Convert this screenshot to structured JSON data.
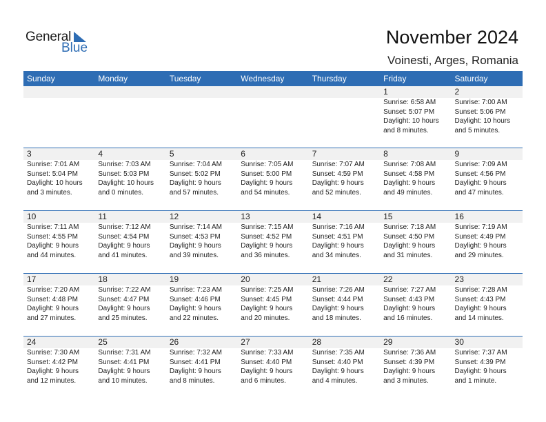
{
  "logo": {
    "line1": "General",
    "line2": "Blue"
  },
  "header": {
    "title": "November 2024",
    "location": "Voinesti, Arges, Romania"
  },
  "colors": {
    "accent": "#2E6DB4",
    "date_band": "#F1F1F1"
  },
  "weekdays": [
    "Sunday",
    "Monday",
    "Tuesday",
    "Wednesday",
    "Thursday",
    "Friday",
    "Saturday"
  ],
  "weeks": [
    [
      null,
      null,
      null,
      null,
      null,
      {
        "day": "1",
        "sunrise": "Sunrise: 6:58 AM",
        "sunset": "Sunset: 5:07 PM",
        "daylight1": "Daylight: 10 hours",
        "daylight2": "and 8 minutes."
      },
      {
        "day": "2",
        "sunrise": "Sunrise: 7:00 AM",
        "sunset": "Sunset: 5:06 PM",
        "daylight1": "Daylight: 10 hours",
        "daylight2": "and 5 minutes."
      }
    ],
    [
      {
        "day": "3",
        "sunrise": "Sunrise: 7:01 AM",
        "sunset": "Sunset: 5:04 PM",
        "daylight1": "Daylight: 10 hours",
        "daylight2": "and 3 minutes."
      },
      {
        "day": "4",
        "sunrise": "Sunrise: 7:03 AM",
        "sunset": "Sunset: 5:03 PM",
        "daylight1": "Daylight: 10 hours",
        "daylight2": "and 0 minutes."
      },
      {
        "day": "5",
        "sunrise": "Sunrise: 7:04 AM",
        "sunset": "Sunset: 5:02 PM",
        "daylight1": "Daylight: 9 hours",
        "daylight2": "and 57 minutes."
      },
      {
        "day": "6",
        "sunrise": "Sunrise: 7:05 AM",
        "sunset": "Sunset: 5:00 PM",
        "daylight1": "Daylight: 9 hours",
        "daylight2": "and 54 minutes."
      },
      {
        "day": "7",
        "sunrise": "Sunrise: 7:07 AM",
        "sunset": "Sunset: 4:59 PM",
        "daylight1": "Daylight: 9 hours",
        "daylight2": "and 52 minutes."
      },
      {
        "day": "8",
        "sunrise": "Sunrise: 7:08 AM",
        "sunset": "Sunset: 4:58 PM",
        "daylight1": "Daylight: 9 hours",
        "daylight2": "and 49 minutes."
      },
      {
        "day": "9",
        "sunrise": "Sunrise: 7:09 AM",
        "sunset": "Sunset: 4:56 PM",
        "daylight1": "Daylight: 9 hours",
        "daylight2": "and 47 minutes."
      }
    ],
    [
      {
        "day": "10",
        "sunrise": "Sunrise: 7:11 AM",
        "sunset": "Sunset: 4:55 PM",
        "daylight1": "Daylight: 9 hours",
        "daylight2": "and 44 minutes."
      },
      {
        "day": "11",
        "sunrise": "Sunrise: 7:12 AM",
        "sunset": "Sunset: 4:54 PM",
        "daylight1": "Daylight: 9 hours",
        "daylight2": "and 41 minutes."
      },
      {
        "day": "12",
        "sunrise": "Sunrise: 7:14 AM",
        "sunset": "Sunset: 4:53 PM",
        "daylight1": "Daylight: 9 hours",
        "daylight2": "and 39 minutes."
      },
      {
        "day": "13",
        "sunrise": "Sunrise: 7:15 AM",
        "sunset": "Sunset: 4:52 PM",
        "daylight1": "Daylight: 9 hours",
        "daylight2": "and 36 minutes."
      },
      {
        "day": "14",
        "sunrise": "Sunrise: 7:16 AM",
        "sunset": "Sunset: 4:51 PM",
        "daylight1": "Daylight: 9 hours",
        "daylight2": "and 34 minutes."
      },
      {
        "day": "15",
        "sunrise": "Sunrise: 7:18 AM",
        "sunset": "Sunset: 4:50 PM",
        "daylight1": "Daylight: 9 hours",
        "daylight2": "and 31 minutes."
      },
      {
        "day": "16",
        "sunrise": "Sunrise: 7:19 AM",
        "sunset": "Sunset: 4:49 PM",
        "daylight1": "Daylight: 9 hours",
        "daylight2": "and 29 minutes."
      }
    ],
    [
      {
        "day": "17",
        "sunrise": "Sunrise: 7:20 AM",
        "sunset": "Sunset: 4:48 PM",
        "daylight1": "Daylight: 9 hours",
        "daylight2": "and 27 minutes."
      },
      {
        "day": "18",
        "sunrise": "Sunrise: 7:22 AM",
        "sunset": "Sunset: 4:47 PM",
        "daylight1": "Daylight: 9 hours",
        "daylight2": "and 25 minutes."
      },
      {
        "day": "19",
        "sunrise": "Sunrise: 7:23 AM",
        "sunset": "Sunset: 4:46 PM",
        "daylight1": "Daylight: 9 hours",
        "daylight2": "and 22 minutes."
      },
      {
        "day": "20",
        "sunrise": "Sunrise: 7:25 AM",
        "sunset": "Sunset: 4:45 PM",
        "daylight1": "Daylight: 9 hours",
        "daylight2": "and 20 minutes."
      },
      {
        "day": "21",
        "sunrise": "Sunrise: 7:26 AM",
        "sunset": "Sunset: 4:44 PM",
        "daylight1": "Daylight: 9 hours",
        "daylight2": "and 18 minutes."
      },
      {
        "day": "22",
        "sunrise": "Sunrise: 7:27 AM",
        "sunset": "Sunset: 4:43 PM",
        "daylight1": "Daylight: 9 hours",
        "daylight2": "and 16 minutes."
      },
      {
        "day": "23",
        "sunrise": "Sunrise: 7:28 AM",
        "sunset": "Sunset: 4:43 PM",
        "daylight1": "Daylight: 9 hours",
        "daylight2": "and 14 minutes."
      }
    ],
    [
      {
        "day": "24",
        "sunrise": "Sunrise: 7:30 AM",
        "sunset": "Sunset: 4:42 PM",
        "daylight1": "Daylight: 9 hours",
        "daylight2": "and 12 minutes."
      },
      {
        "day": "25",
        "sunrise": "Sunrise: 7:31 AM",
        "sunset": "Sunset: 4:41 PM",
        "daylight1": "Daylight: 9 hours",
        "daylight2": "and 10 minutes."
      },
      {
        "day": "26",
        "sunrise": "Sunrise: 7:32 AM",
        "sunset": "Sunset: 4:41 PM",
        "daylight1": "Daylight: 9 hours",
        "daylight2": "and 8 minutes."
      },
      {
        "day": "27",
        "sunrise": "Sunrise: 7:33 AM",
        "sunset": "Sunset: 4:40 PM",
        "daylight1": "Daylight: 9 hours",
        "daylight2": "and 6 minutes."
      },
      {
        "day": "28",
        "sunrise": "Sunrise: 7:35 AM",
        "sunset": "Sunset: 4:40 PM",
        "daylight1": "Daylight: 9 hours",
        "daylight2": "and 4 minutes."
      },
      {
        "day": "29",
        "sunrise": "Sunrise: 7:36 AM",
        "sunset": "Sunset: 4:39 PM",
        "daylight1": "Daylight: 9 hours",
        "daylight2": "and 3 minutes."
      },
      {
        "day": "30",
        "sunrise": "Sunrise: 7:37 AM",
        "sunset": "Sunset: 4:39 PM",
        "daylight1": "Daylight: 9 hours",
        "daylight2": "and 1 minute."
      }
    ]
  ]
}
